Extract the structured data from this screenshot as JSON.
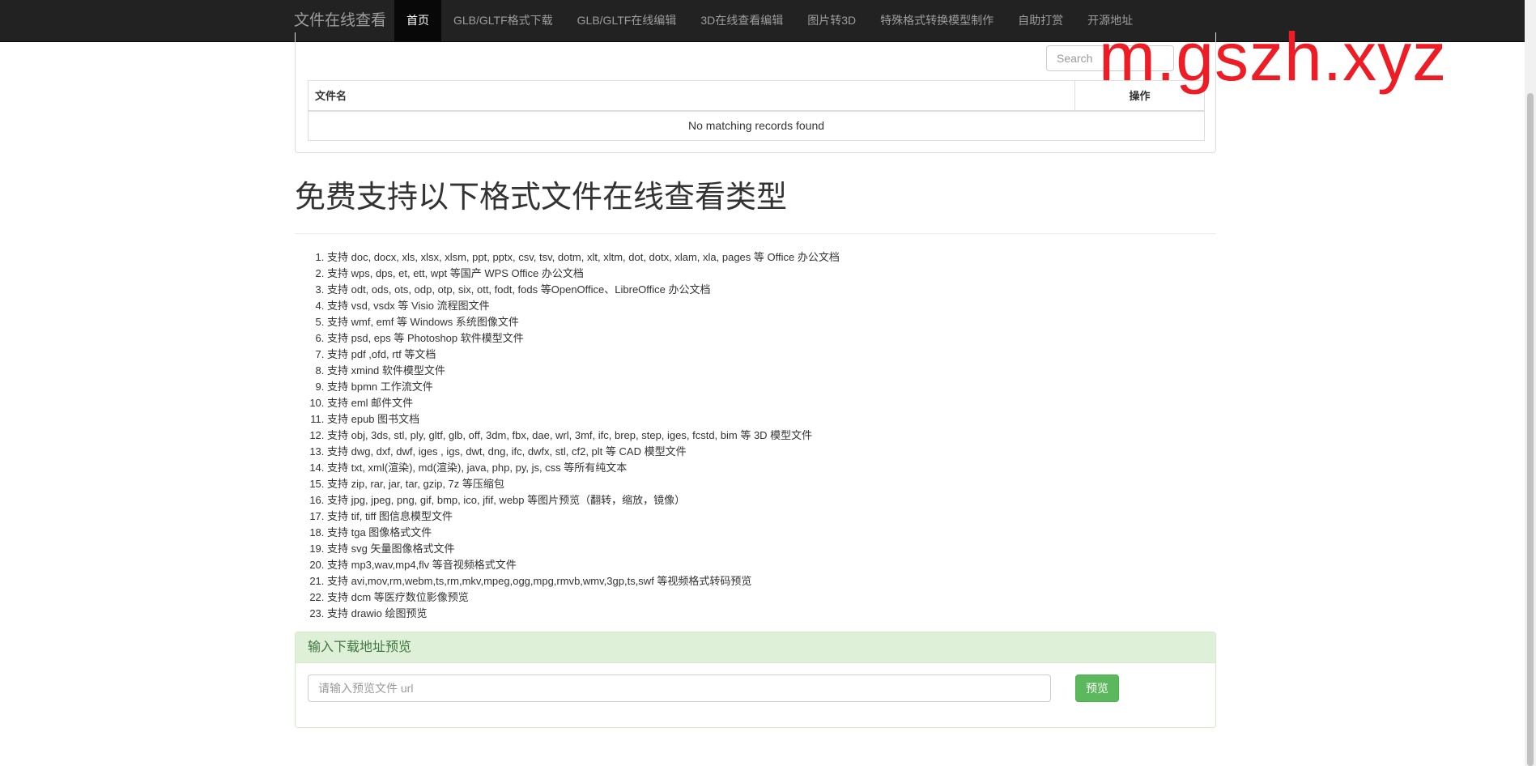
{
  "navbar": {
    "brand": "文件在线查看",
    "items": [
      {
        "label": "首页",
        "active": true
      },
      {
        "label": "GLB/GLTF格式下载"
      },
      {
        "label": "GLB/GLTF在线编辑"
      },
      {
        "label": "3D在线查看编辑"
      },
      {
        "label": "图片转3D"
      },
      {
        "label": "特殊格式转换模型制作"
      },
      {
        "label": "自助打赏"
      },
      {
        "label": "开源地址"
      }
    ]
  },
  "search": {
    "placeholder": "Search"
  },
  "file_table": {
    "headers": [
      "文件名",
      "操作"
    ],
    "empty_message": "No matching records found"
  },
  "watermark": "m.gszh.xyz",
  "page_title": "免费支持以下格式文件在线查看类型",
  "formats": [
    "支持 doc, docx, xls, xlsx, xlsm, ppt, pptx, csv, tsv, dotm, xlt, xltm, dot, dotx, xlam, xla, pages 等 Office 办公文档",
    "支持 wps, dps, et, ett, wpt 等国产 WPS Office 办公文档",
    "支持 odt, ods, ots, odp, otp, six, ott, fodt, fods 等OpenOffice、LibreOffice 办公文档",
    "支持 vsd, vsdx 等 Visio 流程图文件",
    "支持 wmf, emf 等 Windows 系统图像文件",
    "支持 psd, eps 等 Photoshop 软件模型文件",
    "支持 pdf ,ofd, rtf 等文档",
    "支持 xmind 软件模型文件",
    "支持 bpmn 工作流文件",
    "支持 eml 邮件文件",
    "支持 epub 图书文档",
    "支持 obj, 3ds, stl, ply, gltf, glb, off, 3dm, fbx, dae, wrl, 3mf, ifc, brep, step, iges, fcstd, bim 等 3D 模型文件",
    "支持 dwg, dxf, dwf, iges , igs, dwt, dng, ifc, dwfx, stl, cf2, plt 等 CAD 模型文件",
    "支持 txt, xml(渲染), md(渲染), java, php, py, js, css 等所有纯文本",
    "支持 zip, rar, jar, tar, gzip, 7z 等压缩包",
    "支持 jpg, jpeg, png, gif, bmp, ico, jfif, webp 等图片预览（翻转，缩放，镜像）",
    "支持 tif, tiff 图信息模型文件",
    "支持 tga 图像格式文件",
    "支持 svg 矢量图像格式文件",
    "支持 mp3,wav,mp4,flv 等音视频格式文件",
    "支持 avi,mov,rm,webm,ts,rm,mkv,mpeg,ogg,mpg,rmvb,wmv,3gp,ts,swf 等视频格式转码预览",
    "支持 dcm 等医疗数位影像预览",
    "支持 drawio 绘图预览"
  ],
  "url_panel": {
    "heading": "输入下载地址预览",
    "input_placeholder": "请输入预览文件 url",
    "button_label": "预览"
  },
  "colors": {
    "navbar_bg": "#222222",
    "success_green": "#5cb85c",
    "panel_green_bg": "#dff0d8",
    "watermark_red": "#ee1c24"
  }
}
